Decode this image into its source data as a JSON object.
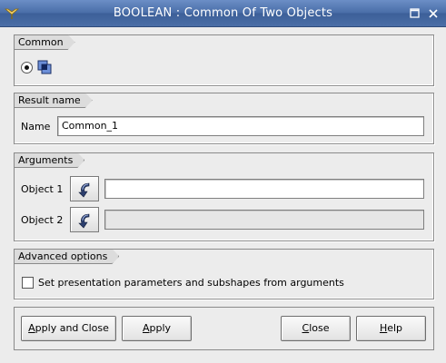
{
  "window": {
    "title": "BOOLEAN : Common Of Two Objects"
  },
  "common_group": {
    "label": "Common",
    "selected_option_icon": "common-operation-icon"
  },
  "result_group": {
    "label": "Result name",
    "name_label": "Name",
    "name_value": "Common_1"
  },
  "arguments_group": {
    "label": "Arguments",
    "object1_label": "Object 1",
    "object1_value": "",
    "object2_label": "Object 2",
    "object2_value": "",
    "select_icon": "selection-arrow-icon"
  },
  "advanced_group": {
    "label": "Advanced options",
    "checkbox_label": "Set presentation parameters and subshapes from arguments",
    "checked": false
  },
  "buttons": {
    "apply_close_pre": "",
    "apply_close_u": "A",
    "apply_close_post": "pply and Close",
    "apply_pre": "",
    "apply_u": "A",
    "apply_post": "pply",
    "close_pre": "",
    "close_u": "C",
    "close_post": "lose",
    "help_pre": "",
    "help_u": "H",
    "help_post": "elp"
  },
  "colors": {
    "titlebar": "#4a6ea8",
    "background": "#ececec"
  }
}
